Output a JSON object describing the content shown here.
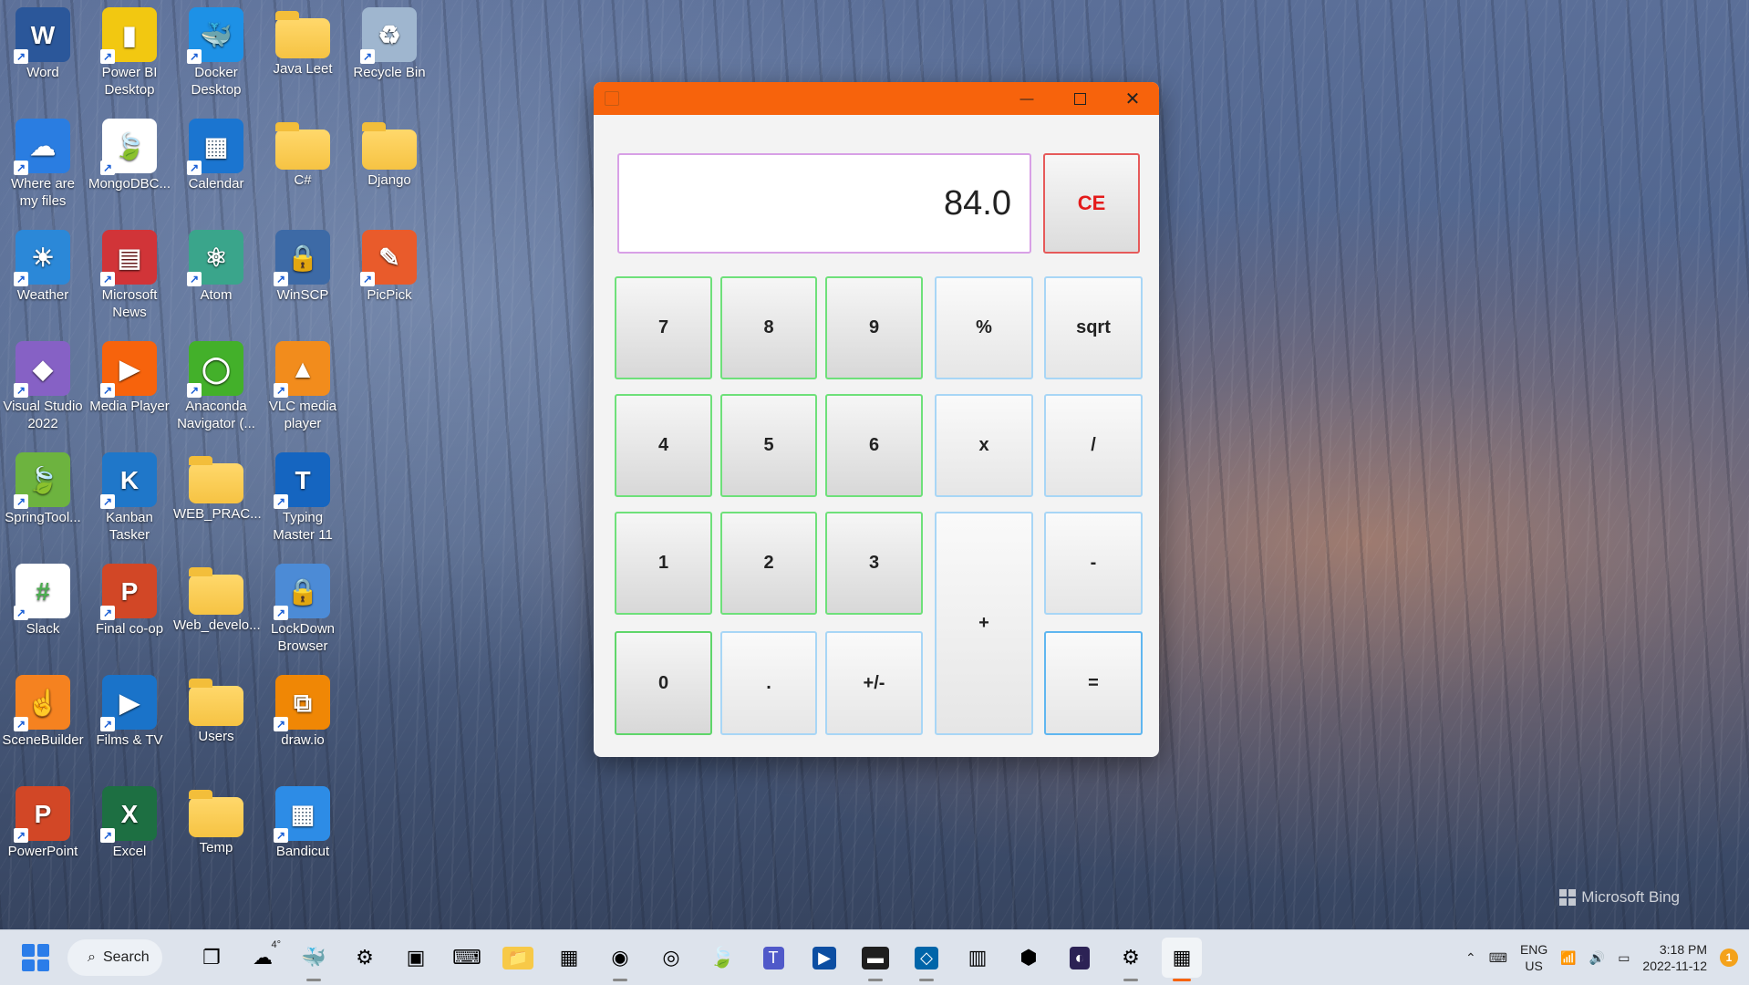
{
  "desktop": {
    "icons": [
      {
        "label": "Word",
        "icon": "word-icon",
        "glyph": "W",
        "color": "#2b579a"
      },
      {
        "label": "Power BI Desktop",
        "icon": "powerbi-icon",
        "glyph": "▮",
        "color": "#f2c811"
      },
      {
        "label": "Docker Desktop",
        "icon": "docker-icon",
        "glyph": "🐳",
        "color": "#1d91e6"
      },
      {
        "label": "Java Leet",
        "icon": "folder-icon",
        "glyph": "",
        "color": "folder"
      },
      {
        "label": "Recycle Bin",
        "icon": "recycle-bin-icon",
        "glyph": "♻",
        "color": "#9fb6cf"
      },
      {
        "label": "Where are my files",
        "icon": "onedrive-icon",
        "glyph": "☁",
        "color": "#2a7de1"
      },
      {
        "label": "MongoDBC...",
        "icon": "mongodb-icon",
        "glyph": "🍃",
        "color": "#ffffff"
      },
      {
        "label": "Calendar",
        "icon": "calendar-icon",
        "glyph": "▦",
        "color": "#1b75d0"
      },
      {
        "label": "C#",
        "icon": "folder-icon",
        "glyph": "",
        "color": "folder"
      },
      {
        "label": "Django",
        "icon": "folder-icon",
        "glyph": "",
        "color": "folder"
      },
      {
        "label": "Weather",
        "icon": "weather-icon",
        "glyph": "☀",
        "color": "#2b88d8"
      },
      {
        "label": "Microsoft News",
        "icon": "news-icon",
        "glyph": "▤",
        "color": "#d13438"
      },
      {
        "label": "Atom",
        "icon": "atom-icon",
        "glyph": "⚛",
        "color": "#3aa58b"
      },
      {
        "label": "WinSCP",
        "icon": "winscp-icon",
        "glyph": "🔒",
        "color": "#3d6aa6"
      },
      {
        "label": "PicPick",
        "icon": "picpick-icon",
        "glyph": "✎",
        "color": "#e95b2b"
      },
      {
        "label": "Visual Studio 2022",
        "icon": "visual-studio-icon",
        "glyph": "◆",
        "color": "#8661c5"
      },
      {
        "label": "Media Player",
        "icon": "media-player-icon",
        "glyph": "▶",
        "color": "#f7630c"
      },
      {
        "label": "Anaconda Navigator (...",
        "icon": "anaconda-icon",
        "glyph": "◯",
        "color": "#43b02a"
      },
      {
        "label": "VLC media player",
        "icon": "vlc-icon",
        "glyph": "▲",
        "color": "#f28c1c"
      },
      {
        "label": "SpringTool...",
        "icon": "spring-icon",
        "glyph": "🍃",
        "color": "#6db33f"
      },
      {
        "label": "Kanban Tasker",
        "icon": "kanban-icon",
        "glyph": "K",
        "color": "#1f77c9"
      },
      {
        "label": "WEB_PRAC...",
        "icon": "folder-icon",
        "glyph": "",
        "color": "folder"
      },
      {
        "label": "Typing Master 11",
        "icon": "typing-master-icon",
        "glyph": "T",
        "color": "#1565c0"
      },
      {
        "label": "Slack",
        "icon": "slack-icon",
        "glyph": "#",
        "color": "#ffffff"
      },
      {
        "label": "Final co-op",
        "icon": "powerpoint-file-icon",
        "glyph": "P",
        "color": "#d24726"
      },
      {
        "label": "Web_develo...",
        "icon": "folder-icon",
        "glyph": "",
        "color": "folder"
      },
      {
        "label": "LockDown Browser",
        "icon": "lockdown-icon",
        "glyph": "🔒",
        "color": "#4c8bd6"
      },
      {
        "label": "SceneBuilder",
        "icon": "scenebuilder-icon",
        "glyph": "☝",
        "color": "#f58220"
      },
      {
        "label": "Films & TV",
        "icon": "films-tv-icon",
        "glyph": "▶",
        "color": "#1a73c9"
      },
      {
        "label": "Users",
        "icon": "folder-icon",
        "glyph": "",
        "color": "folder"
      },
      {
        "label": "draw.io",
        "icon": "drawio-icon",
        "glyph": "⧉",
        "color": "#f08705"
      },
      {
        "label": "PowerPoint",
        "icon": "powerpoint-icon",
        "glyph": "P",
        "color": "#d24726"
      },
      {
        "label": "Excel",
        "icon": "excel-icon",
        "glyph": "X",
        "color": "#1d6f42"
      },
      {
        "label": "Temp",
        "icon": "folder-icon",
        "glyph": "",
        "color": "folder"
      },
      {
        "label": "Bandicut",
        "icon": "bandicut-icon",
        "glyph": "▦",
        "color": "#2d8ce6"
      }
    ]
  },
  "calculator": {
    "display_value": "84.0",
    "clear_label": "CE",
    "keys": {
      "k7": "7",
      "k8": "8",
      "k9": "9",
      "percent": "%",
      "sqrt": "sqrt",
      "k4": "4",
      "k5": "5",
      "k6": "6",
      "multiply": "x",
      "divide": "/",
      "k1": "1",
      "k2": "2",
      "k3": "3",
      "plus": "+",
      "minus": "-",
      "k0": "0",
      "dot": ".",
      "negate": "+/-",
      "equals": "="
    }
  },
  "colors": {
    "titlebar": "#f7630c",
    "clear_text": "#e41b1b"
  },
  "wallpaper": {
    "brand": "Microsoft Bing"
  },
  "taskbar": {
    "search_label": "Search",
    "weather_temp": "4°",
    "apps": [
      "task-view-icon",
      "weather-widget-icon",
      "docker-icon",
      "network-tool-icon",
      "remote-icon",
      "device-manager-icon",
      "file-explorer-icon",
      "store-icon",
      "chrome-icon",
      "edge-icon",
      "mongodb-icon",
      "teams-icon",
      "powershell-icon",
      "terminal-icon",
      "vscode-icon",
      "resource-monitor-icon",
      "app-box-icon",
      "eclipse-icon",
      "settings-icon",
      "calculator-app-icon"
    ],
    "tray": {
      "lang_top": "ENG",
      "lang_bottom": "US",
      "time": "3:18 PM",
      "date": "2022-11-12",
      "notifications": "1"
    }
  }
}
